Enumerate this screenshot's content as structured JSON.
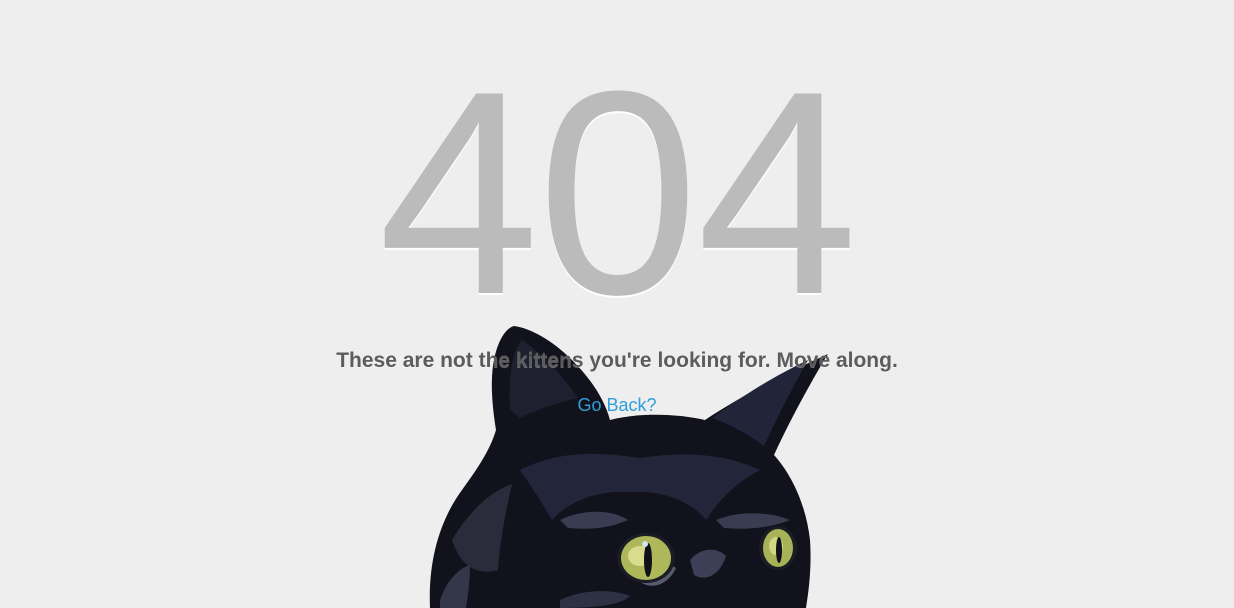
{
  "error": {
    "code": "404",
    "message": "These are not the kittens you're looking for. Move along.",
    "link_label": "Go Back?"
  },
  "colors": {
    "background": "#eeeeee",
    "code": "#bbbbbb",
    "message": "#5c5c5c",
    "link": "#2d9fd9"
  },
  "illustration": {
    "icon": "black-cat-illustration"
  }
}
